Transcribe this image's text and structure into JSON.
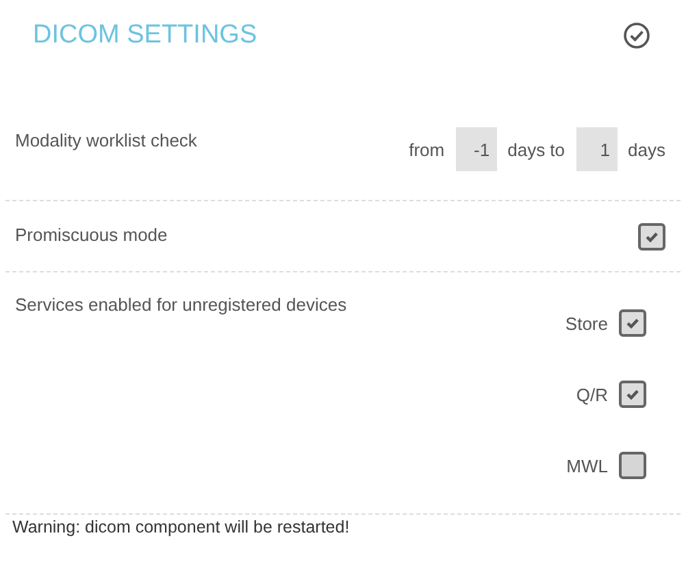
{
  "title": "DICOM SETTINGS",
  "worklist": {
    "label": "Modality worklist check",
    "from_label": "from",
    "from_value": "-1",
    "middle_label": "days to",
    "to_value": "1",
    "end_label": "days"
  },
  "promiscuous": {
    "label": "Promiscuous mode",
    "checked": true
  },
  "services": {
    "label": "Services enabled for unregistered devices",
    "options": [
      {
        "label": "Store",
        "checked": true
      },
      {
        "label": "Q/R",
        "checked": true
      },
      {
        "label": "MWL",
        "checked": false
      }
    ]
  },
  "warning": "Warning: dicom component will be restarted!"
}
